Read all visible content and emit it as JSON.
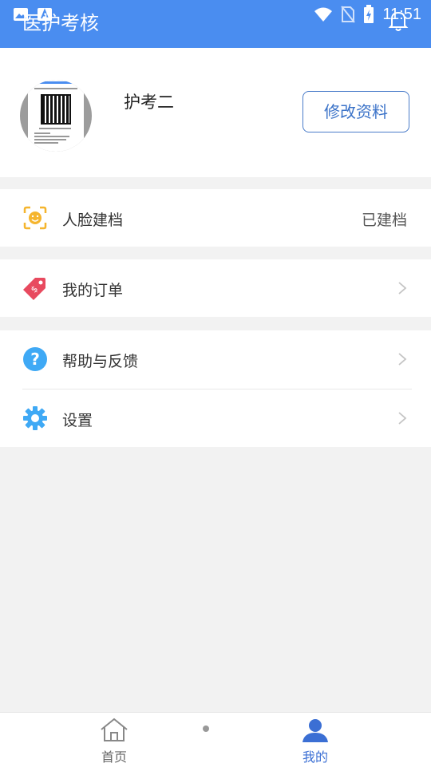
{
  "status_bar": {
    "time": "11:51"
  },
  "app": {
    "title": "医护考核"
  },
  "profile": {
    "username": "护考二",
    "edit_button": "修改资料"
  },
  "menu": {
    "face": {
      "label": "人脸建档",
      "value": "已建档"
    },
    "orders": {
      "label": "我的订单"
    },
    "help": {
      "label": "帮助与反馈"
    },
    "settings": {
      "label": "设置"
    }
  },
  "bottom_nav": {
    "home": "首页",
    "mine": "我的"
  },
  "colors": {
    "primary": "#4a8df0",
    "active_tab": "#3b6fd4",
    "face_icon": "#f5b52e",
    "order_icon": "#e84a5f",
    "help_icon": "#3fa9f5"
  }
}
